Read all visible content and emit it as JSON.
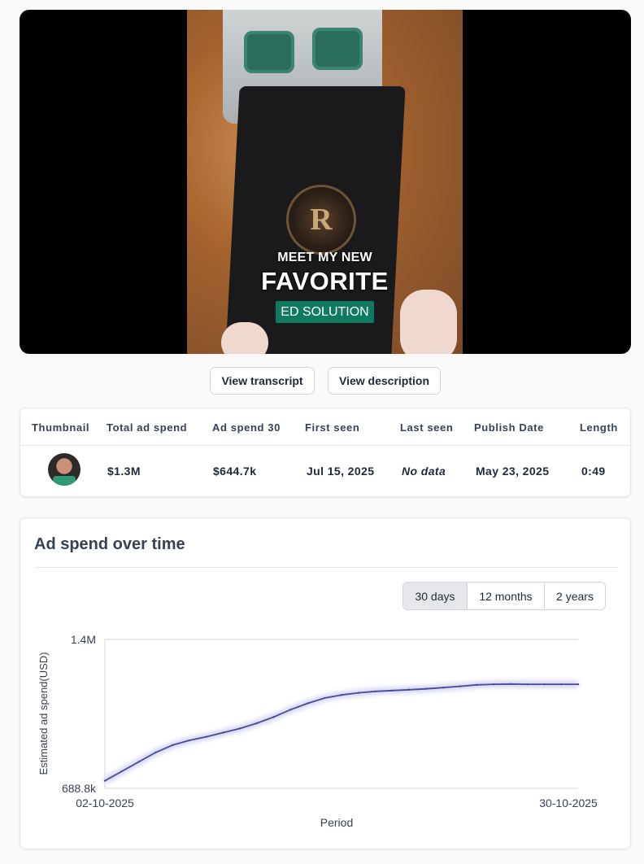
{
  "video": {
    "overlay_line1": "MEET MY NEW",
    "overlay_line2": "FAVORITE",
    "overlay_line3": "ED SOLUTION",
    "logo_letter": "R"
  },
  "actions": {
    "view_transcript": "View transcript",
    "view_description": "View description"
  },
  "table": {
    "headers": [
      "Thumbnail",
      "Total ad spend",
      "Ad spend 30",
      "First seen",
      "Last seen",
      "Publish Date",
      "Length"
    ],
    "row": {
      "total_ad_spend": "$1.3M",
      "ad_spend_30": "$644.7k",
      "first_seen": "Jul 15, 2025",
      "last_seen": "No data",
      "publish_date": "May 23, 2025",
      "length": "0:49"
    }
  },
  "chart_section": {
    "title": "Ad spend over time",
    "ranges": [
      "30 days",
      "12 months",
      "2 years"
    ],
    "selected_range": "30 days"
  },
  "chart_data": {
    "type": "line",
    "xlabel": "Period",
    "ylabel": "Estimated ad spend(USD)",
    "x_tick_labels": [
      "02-10-2025",
      "30-10-2025"
    ],
    "y_tick_labels": [
      "688.8k",
      "1.4M"
    ],
    "ylim": [
      688800,
      1400000
    ],
    "x": [
      "02-10-2025",
      "03-10-2025",
      "04-10-2025",
      "05-10-2025",
      "06-10-2025",
      "07-10-2025",
      "08-10-2025",
      "09-10-2025",
      "10-10-2025",
      "11-10-2025",
      "12-10-2025",
      "13-10-2025",
      "14-10-2025",
      "15-10-2025",
      "16-10-2025",
      "17-10-2025",
      "18-10-2025",
      "19-10-2025",
      "20-10-2025",
      "21-10-2025",
      "22-10-2025",
      "23-10-2025",
      "24-10-2025",
      "25-10-2025",
      "26-10-2025",
      "27-10-2025",
      "28-10-2025",
      "29-10-2025",
      "30-10-2025"
    ],
    "series": [
      {
        "values": [
          725000,
          770000,
          815000,
          860000,
          895000,
          918000,
          935000,
          955000,
          975000,
          1000000,
          1030000,
          1065000,
          1095000,
          1120000,
          1135000,
          1145000,
          1152000,
          1156000,
          1160000,
          1164000,
          1170000,
          1176000,
          1183000,
          1186000,
          1187000,
          1186000,
          1186000,
          1186000,
          1186000
        ],
        "color": "#4a4a9a"
      }
    ],
    "grid": "top-border-only",
    "line_glow_color": "#c7c9ee"
  }
}
